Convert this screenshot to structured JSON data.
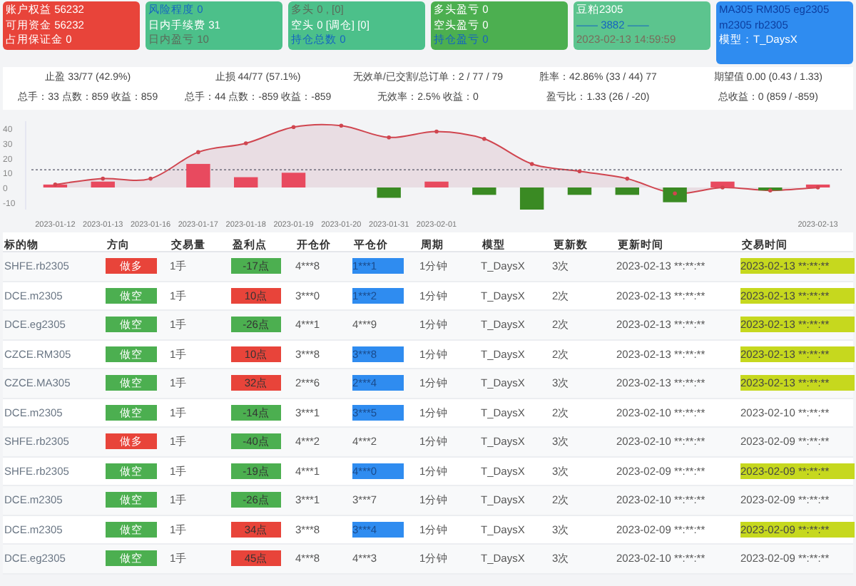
{
  "cards": [
    {
      "color": "#e8443a",
      "lines": [
        {
          "text": "账户权益 56232",
          "color": "#ffffff"
        },
        {
          "text": "可用资金 56232",
          "color": "#ffffff"
        },
        {
          "text": "占用保证金 0",
          "color": "#ffffff"
        }
      ]
    },
    {
      "color": "#4cc08a",
      "lines": [
        {
          "text": "风险程度 0",
          "color": "#1565c0"
        },
        {
          "text": "日内手续费 31",
          "color": "#ffffff"
        },
        {
          "text": "日内盈亏 10",
          "color": "#5a6b5a"
        }
      ]
    },
    {
      "color": "#4cc08a",
      "lines": [
        {
          "text": "多头 0 , [0]",
          "color": "#5a6b5a"
        },
        {
          "text": "空头 0 [调仓] [0]",
          "color": "#ffffff"
        },
        {
          "text": "持仓总数 0",
          "color": "#1565c0"
        }
      ]
    },
    {
      "color": "#4caf50",
      "lines": [
        {
          "text": "多头盈亏 0",
          "color": "#ffffff"
        },
        {
          "text": "空头盈亏 0",
          "color": "#ffffff"
        },
        {
          "text": "持仓盈亏 0",
          "color": "#1565c0"
        }
      ]
    },
    {
      "color": "#5cc48e",
      "lines": [
        {
          "text": "豆粕2305",
          "color": "#ffffff"
        },
        {
          "text": "—— 3882 ——",
          "color": "#1565c0"
        },
        {
          "text": "2023-02-13 14:59:59",
          "color": "#7a6b5a"
        }
      ]
    },
    {
      "color": "#2f8cf0",
      "lines": [
        {
          "text": "MA305 RM305 eg2305",
          "color": "#0d3fa0"
        },
        {
          "text": "m2305 rb2305",
          "color": "#0d3fa0"
        },
        {
          "text": "模型：T_DaysX",
          "color": "#ffffff"
        }
      ]
    }
  ],
  "stats": [
    {
      "top": "止盈 33/77 (42.9%)",
      "bottom": "总手：33 点数：859 收益：859"
    },
    {
      "top": "止损 44/77 (57.1%)",
      "bottom": "总手：44 点数：-859 收益：-859"
    },
    {
      "top": "无效单/已交割/总订单：2 / 77 / 79",
      "bottom": "无效率：2.5% 收益：0"
    },
    {
      "top": "胜率：42.86% (33 / 44) 77",
      "bottom": "盈亏比：1.33 (26 / -20)"
    },
    {
      "top": "期望值 0.00 (0.43 / 1.33)",
      "bottom": "总收益：0 (859 / -859)"
    }
  ],
  "chart_data": {
    "type": "bar",
    "categories": [
      "2023-01-12",
      "2023-01-13",
      "2023-01-16",
      "2023-01-17",
      "2023-01-18",
      "2023-01-19",
      "2023-01-20",
      "2023-01-31",
      "2023-02-01",
      null,
      null,
      null,
      null,
      null,
      null,
      null,
      "2023-02-13"
    ],
    "series": [
      {
        "color": "#e84a5f",
        "values": [
          2,
          4,
          null,
          16,
          7,
          10,
          null,
          null,
          4,
          null,
          null,
          null,
          null,
          null,
          4,
          null,
          2
        ]
      },
      {
        "color": "#3a8a23",
        "values": [
          null,
          null,
          null,
          null,
          null,
          null,
          null,
          -7,
          null,
          -5,
          -15,
          -5,
          -5,
          -10,
          null,
          -2,
          null
        ]
      },
      {
        "type": "line",
        "color": "#d0454f",
        "values": [
          2,
          6,
          6,
          24,
          30,
          41,
          42,
          34,
          38,
          33,
          16,
          11,
          6,
          -4,
          0,
          -2,
          0
        ]
      }
    ],
    "yticks": [
      -10,
      0,
      10,
      20,
      30,
      40
    ],
    "ylim": [
      -15,
      45
    ],
    "ref_lines": [
      {
        "axis": "y",
        "value": 12
      }
    ],
    "stacked": true
  },
  "table": {
    "columns": [
      "标的物",
      "方向",
      "交易量",
      "盈利点",
      "开仓价",
      "平仓价",
      "周期",
      "模型",
      "更新数",
      "更新时间",
      "交易时间"
    ],
    "rows": [
      {
        "symbol": "SHFE.rb2305",
        "direction": {
          "text": "做多",
          "color": "#e8443a"
        },
        "volume": "1手",
        "profit": {
          "text": "-17点",
          "color": "#4caf50"
        },
        "open": "4***8",
        "close": {
          "text": "1***1",
          "highlighted": true
        },
        "period": "1分钟",
        "model": "T_DaysX",
        "updates": "3次",
        "updated": "2023-02-13 **:**:**",
        "traded": {
          "text": "2023-02-13 **:**:**",
          "highlighted": true
        }
      },
      {
        "symbol": "DCE.m2305",
        "direction": {
          "text": "做空",
          "color": "#4caf50"
        },
        "volume": "1手",
        "profit": {
          "text": "10点",
          "color": "#e8443a"
        },
        "open": "3***0",
        "close": {
          "text": "1***2",
          "highlighted": true
        },
        "period": "1分钟",
        "model": "T_DaysX",
        "updates": "2次",
        "updated": "2023-02-13 **:**:**",
        "traded": {
          "text": "2023-02-13 **:**:**",
          "highlighted": true
        }
      },
      {
        "symbol": "DCE.eg2305",
        "direction": {
          "text": "做空",
          "color": "#4caf50"
        },
        "volume": "1手",
        "profit": {
          "text": "-26点",
          "color": "#4caf50"
        },
        "open": "4***1",
        "close": {
          "text": "4***9",
          "highlighted": false
        },
        "period": "1分钟",
        "model": "T_DaysX",
        "updates": "2次",
        "updated": "2023-02-13 **:**:**",
        "traded": {
          "text": "2023-02-13 **:**:**",
          "highlighted": true
        }
      },
      {
        "symbol": "CZCE.RM305",
        "direction": {
          "text": "做空",
          "color": "#4caf50"
        },
        "volume": "1手",
        "profit": {
          "text": "10点",
          "color": "#e8443a"
        },
        "open": "3***8",
        "close": {
          "text": "3***8",
          "highlighted": true
        },
        "period": "1分钟",
        "model": "T_DaysX",
        "updates": "2次",
        "updated": "2023-02-13 **:**:**",
        "traded": {
          "text": "2023-02-13 **:**:**",
          "highlighted": true
        }
      },
      {
        "symbol": "CZCE.MA305",
        "direction": {
          "text": "做空",
          "color": "#4caf50"
        },
        "volume": "1手",
        "profit": {
          "text": "32点",
          "color": "#e8443a"
        },
        "open": "2***6",
        "close": {
          "text": "2***4",
          "highlighted": true
        },
        "period": "1分钟",
        "model": "T_DaysX",
        "updates": "3次",
        "updated": "2023-02-13 **:**:**",
        "traded": {
          "text": "2023-02-13 **:**:**",
          "highlighted": true
        }
      },
      {
        "symbol": "DCE.m2305",
        "direction": {
          "text": "做空",
          "color": "#4caf50"
        },
        "volume": "1手",
        "profit": {
          "text": "-14点",
          "color": "#4caf50"
        },
        "open": "3***1",
        "close": {
          "text": "3***5",
          "highlighted": true
        },
        "period": "1分钟",
        "model": "T_DaysX",
        "updates": "2次",
        "updated": "2023-02-10 **:**:**",
        "traded": {
          "text": "2023-02-10 **:**:**",
          "highlighted": false
        }
      },
      {
        "symbol": "SHFE.rb2305",
        "direction": {
          "text": "做多",
          "color": "#e8443a"
        },
        "volume": "1手",
        "profit": {
          "text": "-40点",
          "color": "#4caf50"
        },
        "open": "4***2",
        "close": {
          "text": "4***2",
          "highlighted": false
        },
        "period": "1分钟",
        "model": "T_DaysX",
        "updates": "3次",
        "updated": "2023-02-10 **:**:**",
        "traded": {
          "text": "2023-02-09 **:**:**",
          "highlighted": false
        }
      },
      {
        "symbol": "SHFE.rb2305",
        "direction": {
          "text": "做空",
          "color": "#4caf50"
        },
        "volume": "1手",
        "profit": {
          "text": "-19点",
          "color": "#4caf50"
        },
        "open": "4***1",
        "close": {
          "text": "4***0",
          "highlighted": true
        },
        "period": "1分钟",
        "model": "T_DaysX",
        "updates": "3次",
        "updated": "2023-02-09 **:**:**",
        "traded": {
          "text": "2023-02-09 **:**:**",
          "highlighted": true
        }
      },
      {
        "symbol": "DCE.m2305",
        "direction": {
          "text": "做空",
          "color": "#4caf50"
        },
        "volume": "1手",
        "profit": {
          "text": "-26点",
          "color": "#4caf50"
        },
        "open": "3***1",
        "close": {
          "text": "3***7",
          "highlighted": false
        },
        "period": "1分钟",
        "model": "T_DaysX",
        "updates": "2次",
        "updated": "2023-02-10 **:**:**",
        "traded": {
          "text": "2023-02-09 **:**:**",
          "highlighted": false
        }
      },
      {
        "symbol": "DCE.m2305",
        "direction": {
          "text": "做空",
          "color": "#4caf50"
        },
        "volume": "1手",
        "profit": {
          "text": "34点",
          "color": "#e8443a"
        },
        "open": "3***8",
        "close": {
          "text": "3***4",
          "highlighted": true
        },
        "period": "1分钟",
        "model": "T_DaysX",
        "updates": "3次",
        "updated": "2023-02-09 **:**:**",
        "traded": {
          "text": "2023-02-09 **:**:**",
          "highlighted": true
        }
      },
      {
        "symbol": "DCE.eg2305",
        "direction": {
          "text": "做空",
          "color": "#4caf50"
        },
        "volume": "1手",
        "profit": {
          "text": "45点",
          "color": "#e8443a"
        },
        "open": "4***8",
        "close": {
          "text": "4***3",
          "highlighted": false
        },
        "period": "1分钟",
        "model": "T_DaysX",
        "updates": "3次",
        "updated": "2023-02-10 **:**:**",
        "traded": {
          "text": "2023-02-09 **:**:**",
          "highlighted": false
        }
      }
    ]
  }
}
